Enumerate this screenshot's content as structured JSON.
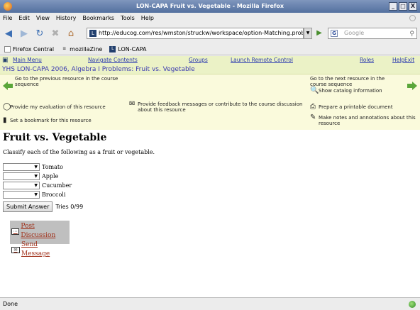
{
  "window": {
    "title": "LON-CAPA Fruit vs. Vegetable - Mozilla Firefox",
    "buttons": [
      "_",
      "□",
      "X"
    ]
  },
  "menubar": [
    "File",
    "Edit",
    "View",
    "History",
    "Bookmarks",
    "Tools",
    "Help"
  ],
  "navbar": {
    "url": "http://educog.com/res/wmston/struckw/workspace/option-Matching.problem?s",
    "search_placeholder": "Google"
  },
  "bookmarks": [
    "Firefox Central",
    "mozillaZine",
    "LON-CAPA"
  ],
  "lc_nav": {
    "main_menu": "Main Menu",
    "navigate": "Navigate Contents",
    "groups": "Groups",
    "remote": "Launch Remote Control",
    "roles": "Roles",
    "help": "Help",
    "exit": "Exit"
  },
  "course_title": "YHS LON-CAPA 2006, Algebra I Problems: Fruit vs. Vegetable",
  "resource_bar": {
    "prev": "Go to the previous resource in the course sequence",
    "next": "Go to the next resource in the course sequence",
    "catalog": "Show catalog information",
    "evaluate": "Provide my evaluation of this resource",
    "feedback": "Provide feedback messages or contribute to the course discussion about this resource",
    "print": "Prepare a printable document",
    "bookmark": "Set a bookmark for this resource",
    "notes": "Make notes and annotations about this resource"
  },
  "problem": {
    "title": "Fruit vs. Vegetable",
    "instructions": "Classify each of the following as a fruit or vegetable.",
    "items": [
      "Tomato",
      "Apple",
      "Cucumber",
      "Broccoli"
    ],
    "submit_label": "Submit Answer",
    "tries": "Tries 0/99"
  },
  "discussion": {
    "post": "Post Discussion",
    "send": "Send Message"
  },
  "status": "Done"
}
